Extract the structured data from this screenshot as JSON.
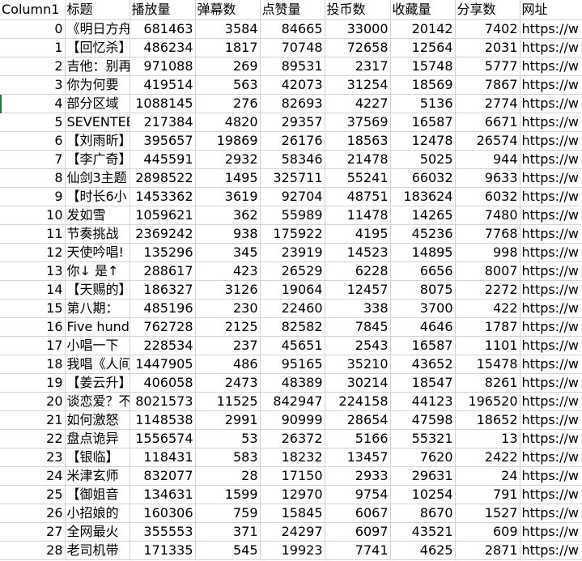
{
  "columns": [
    "Column1",
    "标题",
    "播放量",
    "弹幕数",
    "点赞量",
    "投币数",
    "收藏量",
    "分享数",
    "网址"
  ],
  "rows": [
    [
      "0",
      "《明日方舟",
      "681463",
      "3584",
      "84665",
      "33000",
      "20142",
      "7402",
      "https://w"
    ],
    [
      "1",
      "【回忆杀】",
      "486234",
      "1817",
      "70748",
      "72658",
      "12564",
      "2031",
      "https://w"
    ],
    [
      "2",
      "吉他：别再",
      "971088",
      "269",
      "89531",
      "2317",
      "15748",
      "5777",
      "https://w"
    ],
    [
      "3",
      "你为何要",
      "419514",
      "563",
      "42073",
      "31254",
      "18569",
      "7867",
      "https://w"
    ],
    [
      "4",
      "部分区域",
      "1088145",
      "276",
      "82693",
      "4227",
      "5136",
      "2774",
      "https://w"
    ],
    [
      "5",
      "SEVENTEEN",
      "217384",
      "4820",
      "29357",
      "37569",
      "16587",
      "6671",
      "https://w"
    ],
    [
      "6",
      "【刘雨昕】",
      "395657",
      "19869",
      "26176",
      "18563",
      "12478",
      "26574",
      "https://w"
    ],
    [
      "7",
      "【李广奇】",
      "445591",
      "2932",
      "58346",
      "21478",
      "5025",
      "944",
      "https://w"
    ],
    [
      "8",
      "仙剑3主题",
      "2898522",
      "1495",
      "325711",
      "55241",
      "66032",
      "9633",
      "https://w"
    ],
    [
      "9",
      "【时长6小",
      "1453362",
      "3619",
      "92704",
      "48751",
      "183624",
      "6032",
      "https://w"
    ],
    [
      "10",
      "发如雪",
      "1059621",
      "362",
      "55989",
      "11478",
      "14265",
      "7480",
      "https://w"
    ],
    [
      "11",
      "节奏挑战",
      "2369242",
      "938",
      "175922",
      "4195",
      "45236",
      "7768",
      "https://w"
    ],
    [
      "12",
      "天使吟唱!",
      "135296",
      "345",
      "23919",
      "14523",
      "14895",
      "998",
      "https://w"
    ],
    [
      "13",
      "你↓ 是↑",
      "288617",
      "423",
      "26529",
      "6228",
      "6656",
      "8007",
      "https://w"
    ],
    [
      "14",
      "【天赐的】",
      "186327",
      "3126",
      "19064",
      "12457",
      "8075",
      "2272",
      "https://w"
    ],
    [
      "15",
      "第八期：",
      "485196",
      "230",
      "22460",
      "338",
      "3700",
      "422",
      "https://w"
    ],
    [
      "16",
      "Five hund",
      "762728",
      "2125",
      "82582",
      "7845",
      "4646",
      "1787",
      "https://w"
    ],
    [
      "17",
      "小唱一下",
      "228534",
      "237",
      "45651",
      "2543",
      "16587",
      "1101",
      "https://w"
    ],
    [
      "18",
      "我唱《人间",
      "1447905",
      "486",
      "95165",
      "35210",
      "43652",
      "15478",
      "https://w"
    ],
    [
      "19",
      "【姜云升】",
      "406058",
      "2473",
      "48389",
      "30214",
      "18547",
      "8261",
      "https://w"
    ],
    [
      "20",
      "谈恋爱？不",
      "8021573",
      "11525",
      "842947",
      "224158",
      "44123",
      "196520",
      "https://w"
    ],
    [
      "21",
      "如何激怒",
      "1148538",
      "2991",
      "90999",
      "28654",
      "47598",
      "18652",
      "https://w"
    ],
    [
      "22",
      "盘点诡异",
      "1556574",
      "53",
      "26372",
      "5166",
      "55321",
      "13",
      "https://w"
    ],
    [
      "23",
      "【银临】",
      "118431",
      "583",
      "18232",
      "13457",
      "7620",
      "2422",
      "https://w"
    ],
    [
      "24",
      "米津玄师",
      "832077",
      "28",
      "17150",
      "2933",
      "29631",
      "24",
      "https://w"
    ],
    [
      "25",
      "【御姐音",
      "134631",
      "1599",
      "12970",
      "9754",
      "10254",
      "791",
      "https://w"
    ],
    [
      "26",
      "小招娘的",
      "160306",
      "759",
      "15845",
      "6067",
      "8670",
      "1527",
      "https://w"
    ],
    [
      "27",
      "全网最火",
      "355553",
      "371",
      "24297",
      "6097",
      "43521",
      "609",
      "https://w"
    ],
    [
      "28",
      "老司机带",
      "171335",
      "545",
      "19923",
      "7741",
      "4625",
      "2871",
      "https://w"
    ]
  ],
  "colors": {
    "gridline": "#d4d4d4",
    "row_marker": "#1f7a3c"
  }
}
